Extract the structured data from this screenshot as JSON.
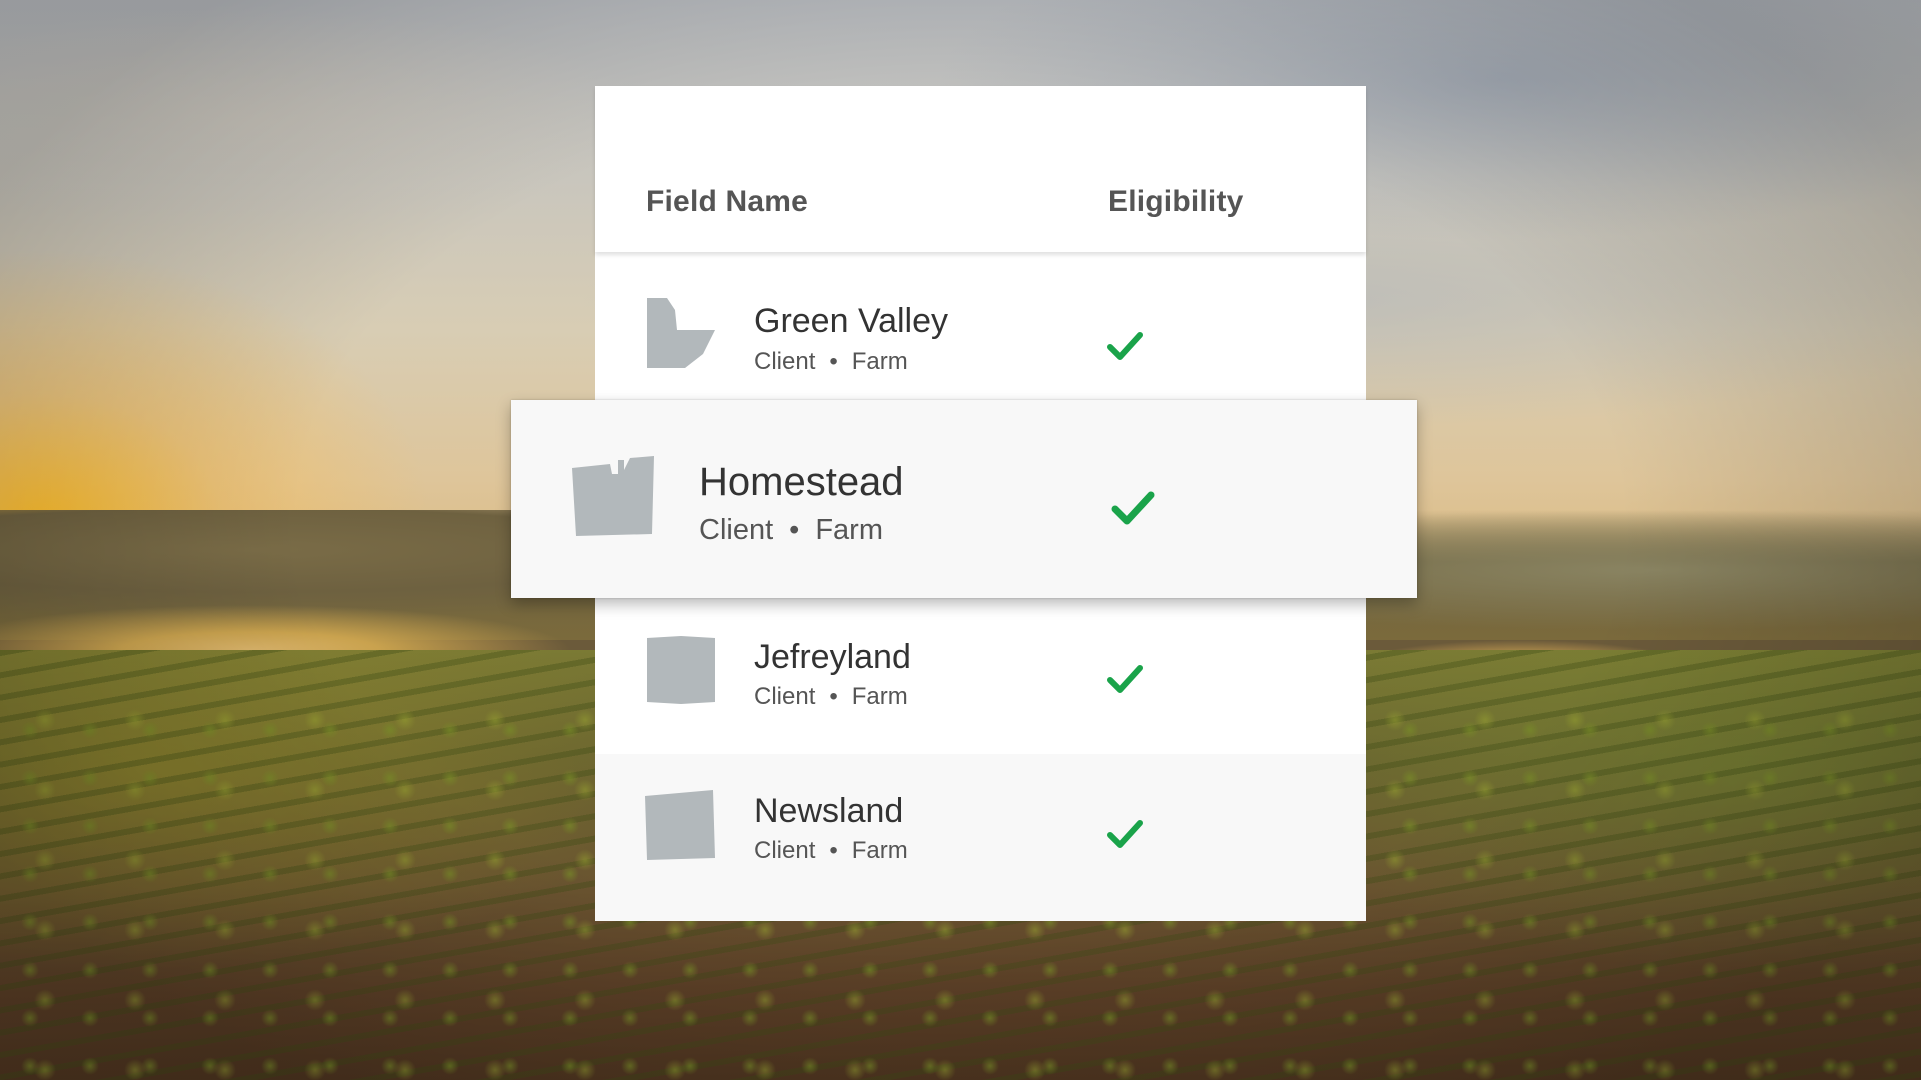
{
  "table": {
    "header": {
      "field_name": "Field Name",
      "eligibility": "Eligibility"
    },
    "rows": [
      {
        "name": "Green Valley",
        "client": "Client",
        "separator": "•",
        "farm": "Farm",
        "eligible": true,
        "shape_icon": "field-boundary-icon"
      },
      {
        "name": "Homestead",
        "client": "Client",
        "separator": "•",
        "farm": "Farm",
        "eligible": true,
        "shape_icon": "field-boundary-icon",
        "highlighted": true
      },
      {
        "name": "Jefreyland",
        "client": "Client",
        "separator": "•",
        "farm": "Farm",
        "eligible": true,
        "shape_icon": "field-boundary-icon"
      },
      {
        "name": "Newsland",
        "client": "Client",
        "separator": "•",
        "farm": "Farm",
        "eligible": true,
        "shape_icon": "field-boundary-icon"
      }
    ]
  },
  "colors": {
    "check": "#1aa34a",
    "field_shape": "#b2b8bb",
    "card_background": "#ffffff",
    "highlight_background": "#f8f8f8"
  }
}
